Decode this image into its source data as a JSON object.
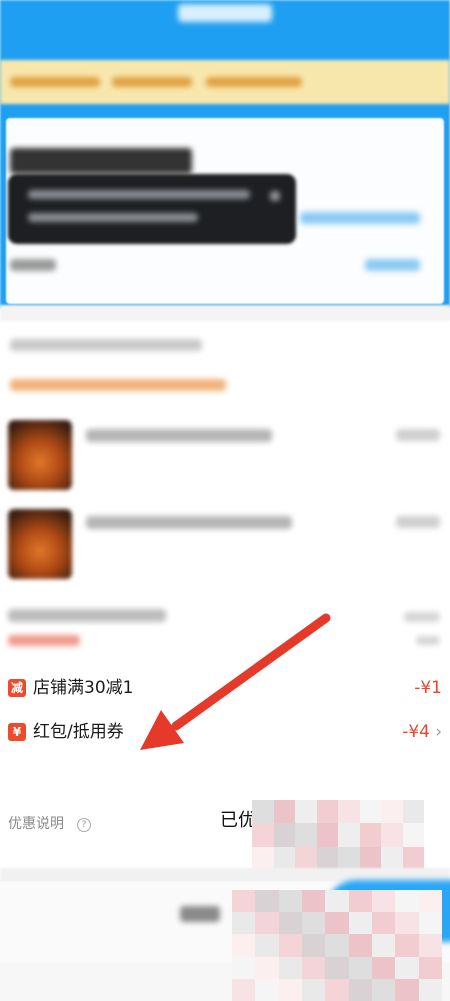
{
  "colors": {
    "header_blue": "#1f9ff1",
    "banner_yellow": "#f8e7ad",
    "discount_red": "#e8472c",
    "annotation_arrow": "#e5392a"
  },
  "discounts": [
    {
      "icon": "减",
      "label": "店铺满30减1",
      "amount": "-¥1"
    },
    {
      "icon": "¥",
      "label": "红包/抵用券",
      "amount": "-¥4",
      "chevron": "›"
    }
  ],
  "promo_note": {
    "label": "优惠说明",
    "icon": "?"
  },
  "saved": {
    "label": "已优惠"
  }
}
